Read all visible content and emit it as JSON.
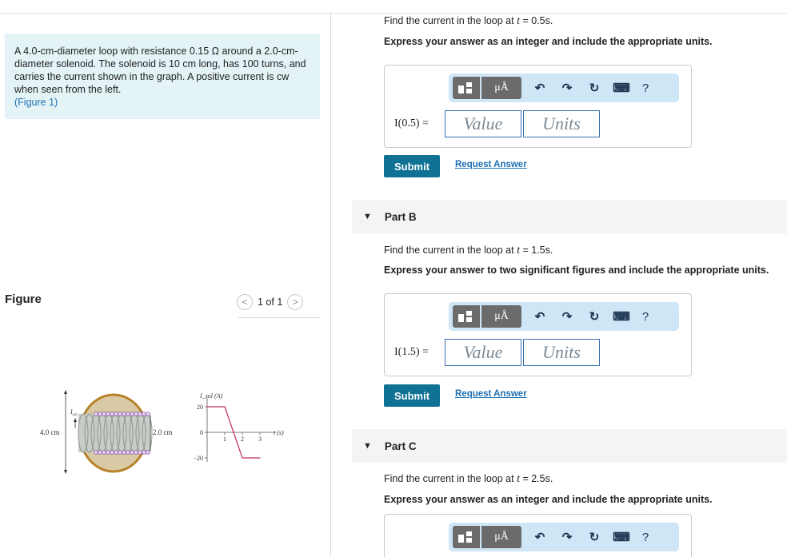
{
  "problem": {
    "text": "A 4.0-cm-diameter loop with resistance 0.15 Ω around a 2.0-cm-diameter solenoid. The solenoid is 10 cm long, has 100 turns, and carries the current shown in the graph. A positive current is cw when seen from the left.",
    "figure_link": "(Figure 1)"
  },
  "figure_panel": {
    "label": "Figure",
    "pager": "1 of 1",
    "prev_glyph": "<",
    "next_glyph": ">",
    "diagram": {
      "loop_diameter_label": "4.0 cm",
      "solenoid_diameter_label": "2.0 cm",
      "current_label": "I",
      "current_sub": "sol"
    }
  },
  "chart_data": {
    "type": "line",
    "ylabel": "I_sol (A)",
    "xlabel": "t (s)",
    "x": [
      0,
      1,
      2,
      3
    ],
    "y": [
      20,
      20,
      -20,
      -20
    ],
    "yticks": [
      "20",
      "0",
      "−20"
    ],
    "xticks": [
      "1",
      "2",
      "3"
    ],
    "ylim": [
      -20,
      20
    ],
    "xlim": [
      0,
      3
    ]
  },
  "toolbar": {
    "units_glyph": "μÅ",
    "undo_glyph": "↶",
    "redo_glyph": "↷",
    "reset_glyph": "↻",
    "keyboard_glyph": "⌨",
    "help_glyph": "?"
  },
  "partA": {
    "question_prefix": "Find the current in the loop at ",
    "t_symbol": "t",
    "question_suffix": " = 0.5s.",
    "instruction": "Express your answer as an integer and include the appropriate units.",
    "answer_label": "I(0.5) =",
    "value_placeholder": "Value",
    "units_placeholder": "Units",
    "submit": "Submit",
    "request": "Request Answer"
  },
  "partB": {
    "title": "Part B",
    "question_prefix": "Find the current in the loop at ",
    "t_symbol": "t",
    "question_suffix": " = 1.5s.",
    "instruction": "Express your answer to two significant figures and include the appropriate units.",
    "answer_label": "I(1.5) =",
    "value_placeholder": "Value",
    "units_placeholder": "Units",
    "submit": "Submit",
    "request": "Request Answer"
  },
  "partC": {
    "title": "Part C",
    "question_prefix": "Find the current in the loop at ",
    "t_symbol": "t",
    "question_suffix": " = 2.5s.",
    "instruction": "Express your answer as an integer and include the appropriate units."
  }
}
